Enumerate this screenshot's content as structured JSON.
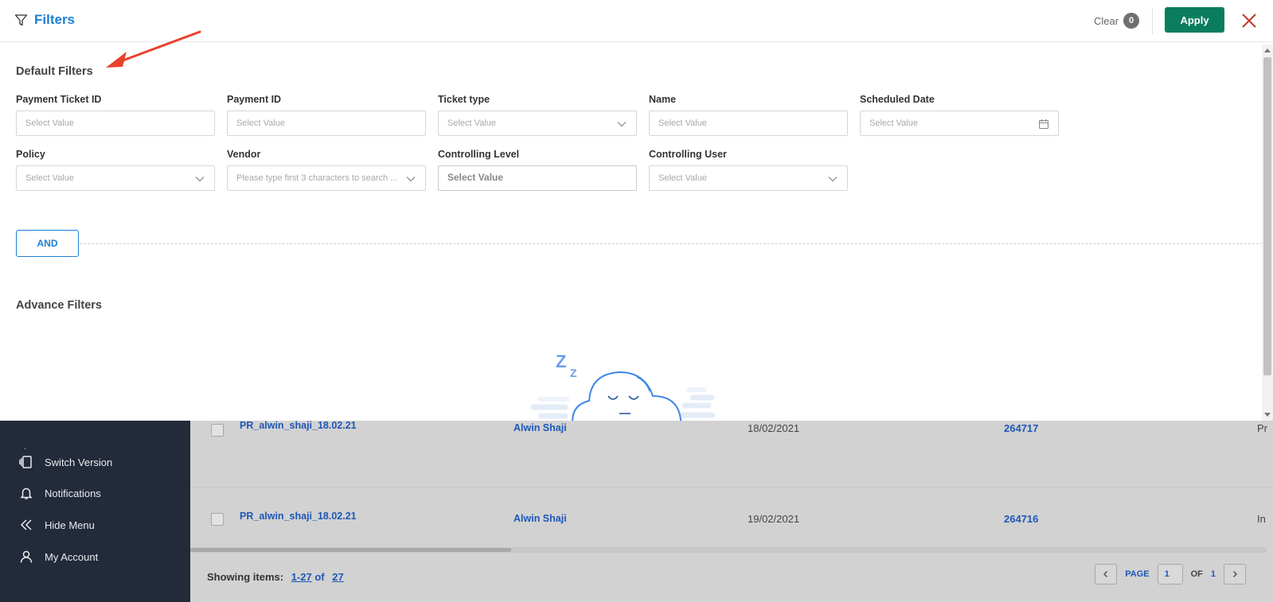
{
  "filters_panel": {
    "title": "Filters",
    "clear_label": "Clear",
    "clear_count": "0",
    "apply_label": "Apply",
    "default_filters_title": "Default Filters",
    "advance_filters_title": "Advance Filters",
    "and_label": "AND",
    "fields": {
      "payment_ticket_id": {
        "label": "Payment Ticket ID",
        "placeholder": "Select Value"
      },
      "payment_id": {
        "label": "Payment ID",
        "placeholder": "Select Value"
      },
      "ticket_type": {
        "label": "Ticket type",
        "placeholder": "Select Value"
      },
      "name": {
        "label": "Name",
        "placeholder": "Select Value"
      },
      "scheduled_date": {
        "label": "Scheduled Date",
        "placeholder": "Select Value"
      },
      "policy": {
        "label": "Policy",
        "placeholder": "Select Value"
      },
      "vendor": {
        "label": "Vendor",
        "placeholder": "Please type first 3 characters to search ..."
      },
      "controlling_level": {
        "label": "Controlling Level",
        "placeholder": "Select Value"
      },
      "controlling_user": {
        "label": "Controlling User",
        "placeholder": "Select Value"
      }
    }
  },
  "sidebar": {
    "items": [
      {
        "label": "Switch Version",
        "icon": "switch-version-icon"
      },
      {
        "label": "Notifications",
        "icon": "bell-icon"
      },
      {
        "label": "Hide Menu",
        "icon": "double-chevron-left-icon"
      },
      {
        "label": "My Account",
        "icon": "user-icon"
      }
    ]
  },
  "table": {
    "rows": [
      {
        "name": "PR_alwin_shaji_18.02.21",
        "user": "Alwin Shaji",
        "date": "18/02/2021",
        "id": "264717",
        "status": "Pr"
      },
      {
        "name": "PR_alwin_shaji_18.02.21",
        "user": "Alwin Shaji",
        "date": "19/02/2021",
        "id": "264716",
        "status": "In"
      }
    ]
  },
  "footer": {
    "showing_label": "Showing items:",
    "range_start": "1",
    "range_end": "27",
    "of_label": "of",
    "total": "27",
    "page_label": "PAGE",
    "page_value": "1",
    "page_of_label": "OF",
    "page_total": "1"
  },
  "colors": {
    "accent": "#1b7fd4",
    "apply": "#0a7d5f",
    "close": "#c0392b",
    "sidebar": "#232a39",
    "annotation_arrow": "#e8412c"
  }
}
